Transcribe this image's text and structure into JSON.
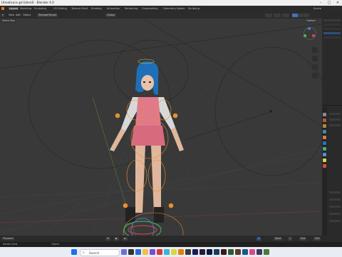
{
  "window": {
    "title": "[Amelicura girl.blend] - Blender 4.0",
    "min": "–",
    "max": "□",
    "close": "✕"
  },
  "menubar": {
    "items": [
      "Layout",
      "Modeling",
      "Sculpting",
      "UV Editing",
      "Texture Paint",
      "Shading",
      "Animation",
      "Rendering",
      "Compositing",
      "Geometry Nodes",
      "Scripting"
    ],
    "scene_label": "Scene"
  },
  "header": {
    "mode_menu": [
      "View",
      "Add",
      "Object"
    ],
    "orientation_label": "Global",
    "select_box": "Select Box",
    "pose_label": "RetargetTarget"
  },
  "viewport": {
    "options_label": "Options"
  },
  "timeline": {
    "current_frame": "1",
    "start_label": "Start",
    "start_value": "1",
    "end_label": "End",
    "end_value": "250",
    "playback_label": "Playback"
  },
  "statusbar": {
    "left": "Rotate View",
    "right": "Object"
  },
  "taskbar": {
    "search_placeholder": "Search"
  },
  "colors": {
    "accent": "#4772b3",
    "rig_orange": "#e8902c",
    "background": "#393939"
  }
}
